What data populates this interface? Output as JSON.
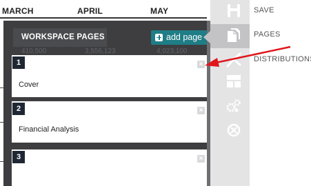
{
  "spreadsheet": {
    "months": [
      "MARCH",
      "APRIL",
      "MAY"
    ],
    "ghost_values": [
      "410,500",
      "3,556,123",
      "4,023,100"
    ]
  },
  "workspace_pages": {
    "title": "WORKSPACE PAGES",
    "add_page_label": "add page",
    "pages": [
      {
        "number": "1",
        "title": "Cover"
      },
      {
        "number": "2",
        "title": "Financial Analysis"
      },
      {
        "number": "3",
        "title": ""
      }
    ]
  },
  "toolbar": {
    "items": [
      {
        "label": "SAVE",
        "icon": "save-icon"
      },
      {
        "label": "PAGES",
        "icon": "pages-icon",
        "active": true
      },
      {
        "label": "DISTRIBUTIONS",
        "icon": "distributions-icon"
      },
      {
        "label": "",
        "icon": "layout-icon"
      },
      {
        "label": "",
        "icon": "settings-gears-icon"
      },
      {
        "label": "",
        "icon": "close-circle-icon"
      }
    ]
  },
  "colors": {
    "panel_bg": "#3e3e40",
    "accent_teal": "#1f7d86",
    "annotation_arrow": "#e0161b"
  }
}
